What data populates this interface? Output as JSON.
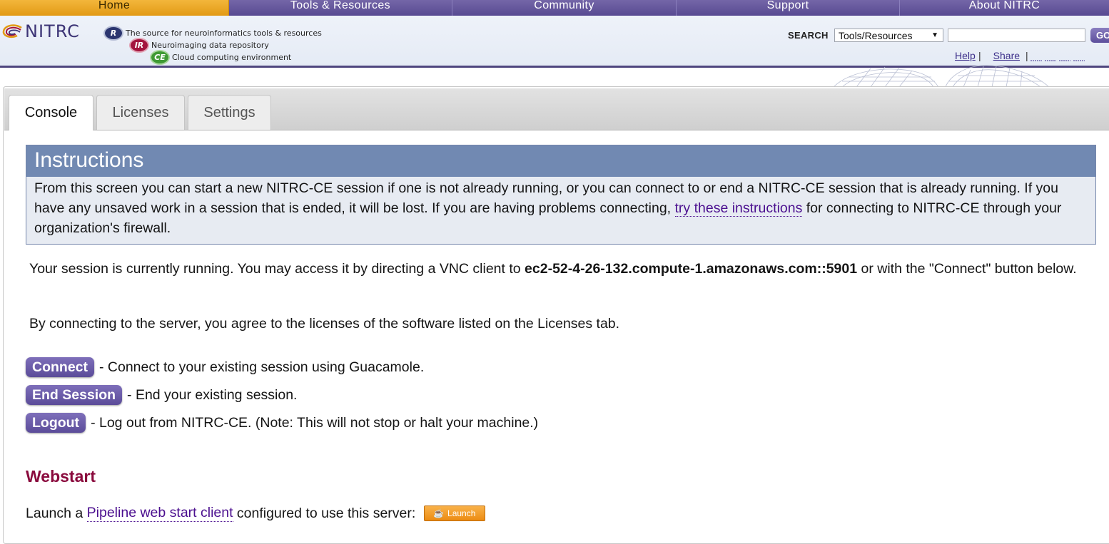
{
  "nav": {
    "items": [
      "Home",
      "Tools & Resources",
      "Community",
      "Support",
      "About NITRC"
    ],
    "active_index": 0
  },
  "header": {
    "logo_text": "NITRC",
    "taglines": [
      {
        "badge": "R",
        "text": "The source for neuroinformatics tools & resources"
      },
      {
        "badge": "IR",
        "text": "Neuroimaging data repository"
      },
      {
        "badge": "CE",
        "text": "Cloud computing environment"
      }
    ],
    "search_label": "SEARCH",
    "search_scope": "Tools/Resources",
    "search_value": "",
    "go_label": "GO",
    "help_label": "Help",
    "share_label": "Share",
    "separator": "|"
  },
  "tabs": [
    {
      "label": "Console",
      "active": true
    },
    {
      "label": "Licenses",
      "active": false
    },
    {
      "label": "Settings",
      "active": false
    }
  ],
  "instructions": {
    "title": "Instructions",
    "text_before": "From this screen you can start a new NITRC-CE session if one is not already running, or you can connect to or end a NITRC-CE session that is already running. If you have any unsaved work in a session that is ended, it will be lost. If you are having problems connecting, ",
    "link_text": "try these instructions",
    "text_after": " for connecting to NITRC-CE through your organization's firewall."
  },
  "session": {
    "text_before": "Your session is currently running. You may access it by directing a VNC client to ",
    "host": "ec2-52-4-26-132.compute-1.amazonaws.com::5901",
    "text_after": " or with the \"Connect\" button below."
  },
  "agreement": "By connecting to the server, you agree to the licenses of the software listed on the Licenses tab.",
  "actions": [
    {
      "label": "Connect",
      "description": "- Connect to your existing session using Guacamole."
    },
    {
      "label": "End Session",
      "description": "- End your existing session."
    },
    {
      "label": "Logout",
      "description": "- Log out from NITRC-CE. (Note: This will not stop or halt your machine.)"
    }
  ],
  "webstart": {
    "title": "Webstart",
    "text_before": "Launch a ",
    "link_text": "Pipeline web start client",
    "text_after": " configured to use this server: ",
    "launch_label": "Launch"
  },
  "colors": {
    "nav_purple": "#5d4e97",
    "home_orange": "#e29a15",
    "instructions_header": "#7189b2",
    "button_purple": "#5b4c99",
    "webstart_title": "#8a0a3d",
    "link": "#4b0f8f"
  }
}
